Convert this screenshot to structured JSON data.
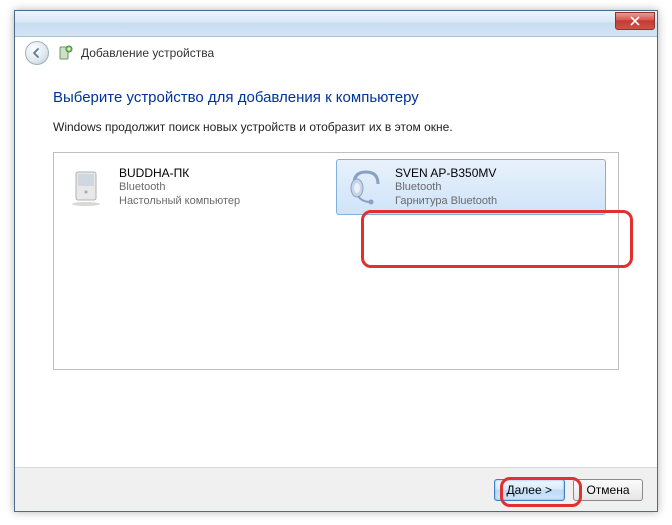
{
  "titlebar": {
    "close_tooltip": "Close"
  },
  "nav": {
    "title": "Добавление устройства"
  },
  "content": {
    "heading": "Выберите устройство для добавления к компьютеру",
    "subtext": "Windows продолжит поиск новых устройств и отобразит их в этом окне."
  },
  "devices": [
    {
      "name": "BUDDHA-ПК",
      "protocol": "Bluetooth",
      "type": "Настольный компьютер",
      "selected": false,
      "icon": "desktop"
    },
    {
      "name": "SVEN AP-B350MV",
      "protocol": "Bluetooth",
      "type": "Гарнитура Bluetooth",
      "selected": true,
      "icon": "headset"
    }
  ],
  "footer": {
    "next_label": "Далее >",
    "cancel_label": "Отмена"
  },
  "colors": {
    "heading": "#003399",
    "highlight": "#e03030"
  }
}
